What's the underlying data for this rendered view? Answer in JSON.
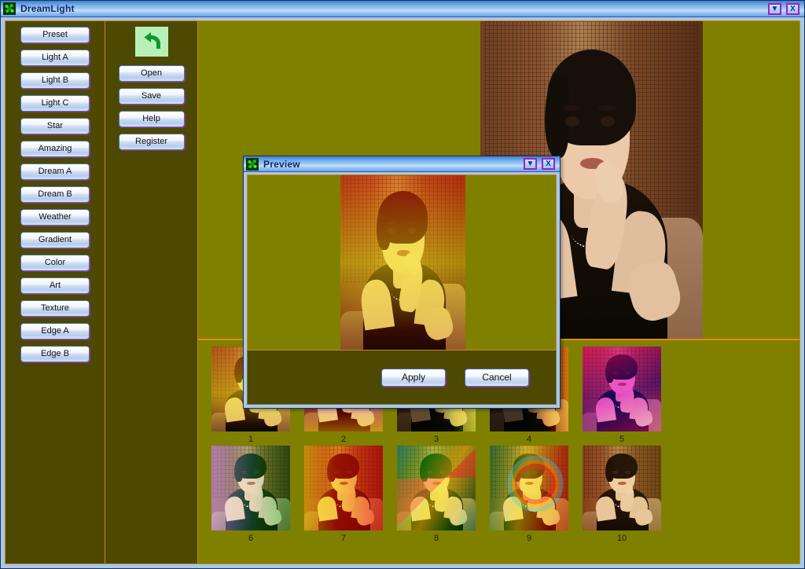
{
  "window": {
    "title": "DreamLight",
    "icon": "app-mosaic-icon",
    "controls": [
      {
        "name": "minimize-button",
        "glyph": "▼"
      },
      {
        "name": "close-button",
        "glyph": "X"
      }
    ]
  },
  "presets": {
    "buttons": [
      "Preset",
      "Light A",
      "Light B",
      "Light C",
      "Star",
      "Amazing",
      "Dream A",
      "Dream B",
      "Weather",
      "Gradient",
      "Color",
      "Art",
      "Texture",
      "Edge A",
      "Edge B"
    ]
  },
  "tools": {
    "undo_icon": "undo-arrow-icon",
    "buttons": [
      "Open",
      "Save",
      "Help",
      "Register"
    ]
  },
  "thumbnails": {
    "row1": [
      {
        "label": "1",
        "effect": "warm-yellow"
      },
      {
        "label": "2",
        "effect": "magenta-neon"
      },
      {
        "label": "3",
        "effect": "lime-split"
      },
      {
        "label": "4",
        "effect": "amber-dark"
      },
      {
        "label": "5",
        "effect": "pink-violet"
      }
    ],
    "row2": [
      {
        "label": "6",
        "effect": "lavender-green"
      },
      {
        "label": "7",
        "effect": "red-yellow"
      },
      {
        "label": "8",
        "effect": "cyan-rainbow-diamond"
      },
      {
        "label": "9",
        "effect": "rainbow-arc"
      },
      {
        "label": "10",
        "effect": "soft-sepia"
      }
    ]
  },
  "preview": {
    "title": "Preview",
    "icon": "app-mosaic-icon",
    "controls": [
      {
        "name": "minimize-button",
        "glyph": "▼"
      },
      {
        "name": "close-button",
        "glyph": "X"
      }
    ],
    "apply_label": "Apply",
    "cancel_label": "Cancel"
  },
  "colors": {
    "titlebar_blue": "#6aa6e4",
    "panel_olive_dark": "#4d4802",
    "canvas_olive": "#808000",
    "divider_orange": "#d08020",
    "button_border_magenta": "#a020c0"
  }
}
